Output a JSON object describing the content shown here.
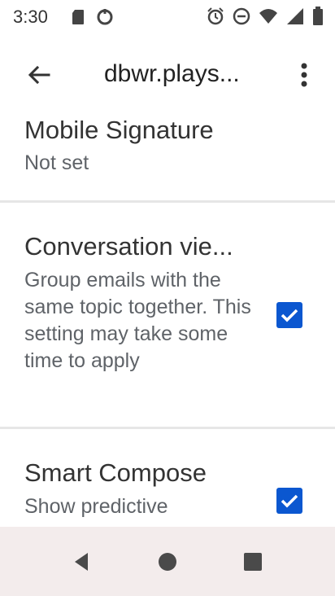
{
  "status_bar": {
    "time": "3:30"
  },
  "app_bar": {
    "title": "dbwr.plays..."
  },
  "settings": [
    {
      "title": "Mobile Signature",
      "summary": "Not set"
    },
    {
      "title": "Conversation vie...",
      "summary": "Group emails with the same topic together. This setting may take some time to apply",
      "checked": true
    },
    {
      "title": "Smart Compose",
      "summary": "Show predictive",
      "checked": true
    }
  ],
  "colors": {
    "accent": "#0b57d0",
    "divider": "#e6e6e6",
    "nav_bg": "#f3ecec"
  },
  "icons": {
    "back": "arrow-back-icon",
    "overflow": "more-vert-icon",
    "nav_back": "nav-back-icon",
    "nav_home": "nav-home-icon",
    "nav_recents": "nav-recents-icon"
  }
}
